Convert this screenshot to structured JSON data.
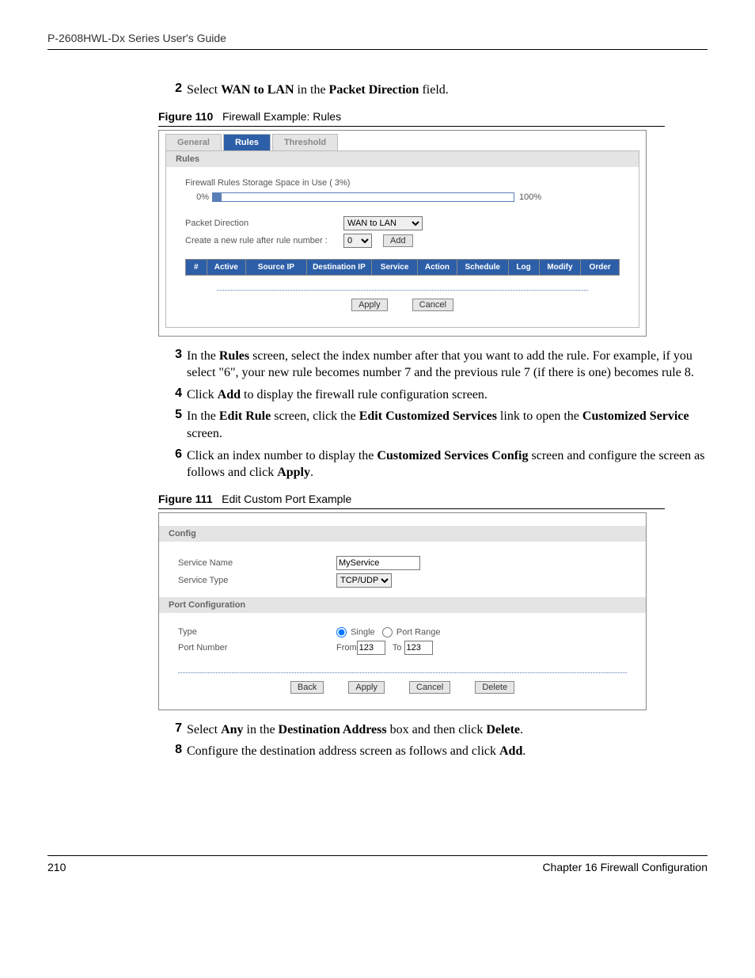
{
  "header": "P-2608HWL-Dx Series User's Guide",
  "step2": {
    "num": "2",
    "pre": "Select ",
    "bold1": "WAN to LAN",
    "mid": " in the ",
    "bold2": "Packet Direction",
    "post": " field."
  },
  "fig110": {
    "label": "Figure 110",
    "title": "Firewall Example: Rules"
  },
  "fig1": {
    "tabs": {
      "general": "General",
      "rules": "Rules",
      "threshold": "Threshold"
    },
    "section": "Rules",
    "storage": "Firewall Rules Storage Space in Use  ( 3%)",
    "pct0": "0%",
    "pct100": "100%",
    "lbl_pd": "Packet Direction",
    "sel_pd": "WAN to LAN",
    "lbl_create": "Create a new rule after rule number :",
    "sel_num": "0",
    "btn_add": "Add",
    "cols": {
      "n": "#",
      "active": "Active",
      "src": "Source IP",
      "dst": "Destination IP",
      "svc": "Service",
      "act": "Action",
      "sch": "Schedule",
      "log": "Log",
      "mod": "Modify",
      "ord": "Order"
    },
    "apply": "Apply",
    "cancel": "Cancel"
  },
  "step3": {
    "num": "3",
    "t1": "In the ",
    "b1": "Rules",
    "t2": " screen, select the index number after that you want to add the rule. For example, if you select \"6\", your new rule becomes number 7 and the previous rule 7 (if there is one) becomes rule 8."
  },
  "step4": {
    "num": "4",
    "t1": "Click ",
    "b1": "Add",
    "t2": " to display the firewall rule configuration screen."
  },
  "step5": {
    "num": "5",
    "t1": "In the ",
    "b1": "Edit Rule",
    "t2": " screen, click the ",
    "b2": "Edit Customized Services",
    "t3": " link to open the ",
    "b3": "Customized Service",
    "t4": " screen."
  },
  "step6": {
    "num": "6",
    "t1": "Click an index number to display the ",
    "b1": "Customized Services Config",
    "t2": " screen and configure the screen as follows and click ",
    "b2": "Apply",
    "t3": "."
  },
  "fig111": {
    "label": "Figure 111",
    "title": "Edit Custom Port Example"
  },
  "fig2": {
    "sec1": "Config",
    "lbl_name": "Service Name",
    "val_name": "MyService",
    "lbl_type": "Service Type",
    "val_type": "TCP/UDP",
    "sec2": "Port Configuration",
    "lbl_ptype": "Type",
    "r_single": "Single",
    "r_range": "Port Range",
    "lbl_pnum": "Port Number",
    "from": "From",
    "to": "To",
    "v_from": "123",
    "v_to": "123",
    "back": "Back",
    "apply": "Apply",
    "cancel": "Cancel",
    "delete": "Delete"
  },
  "step7": {
    "num": "7",
    "t1": "Select ",
    "b1": "Any",
    "t2": " in the ",
    "b2": "Destination Address",
    "t3": " box and then click ",
    "b3": "Delete",
    "t4": "."
  },
  "step8": {
    "num": "8",
    "t1": "Configure the destination address screen as follows and click ",
    "b1": "Add",
    "t2": "."
  },
  "footer": {
    "page": "210",
    "chapter": "Chapter 16 Firewall Configuration"
  }
}
